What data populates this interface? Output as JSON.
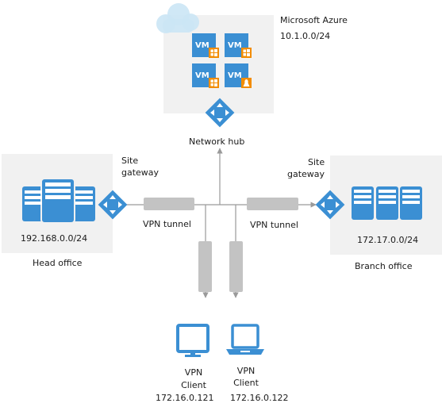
{
  "azure": {
    "title": "Microsoft Azure",
    "subnet": "10.1.0.0/24",
    "vms": [
      {
        "label": "VM",
        "os": "windows"
      },
      {
        "label": "VM",
        "os": "windows"
      },
      {
        "label": "VM",
        "os": "windows"
      },
      {
        "label": "VM",
        "os": "linux"
      }
    ],
    "hub_label": "Network hub"
  },
  "head_office": {
    "name": "Head office",
    "subnet": "192.168.0.0/24",
    "gateway_label_line1": "Site",
    "gateway_label_line2": "gateway",
    "tunnel_label": "VPN tunnel"
  },
  "branch_office": {
    "name": "Branch office",
    "subnet": "172.17.0.0/24",
    "gateway_label_line1": "Site",
    "gateway_label_line2": "gateway",
    "tunnel_label": "VPN tunnel"
  },
  "clients": [
    {
      "line1": "VPN",
      "line2": "Client",
      "ip": "172.16.0.121",
      "device": "desktop"
    },
    {
      "line1": "VPN",
      "line2": "Client",
      "ip": "172.16.0.122",
      "device": "laptop"
    }
  ],
  "colors": {
    "icon_blue": "#3b8fd3",
    "windows_badge": "#f28c00",
    "panel_bg": "#f1f1f1",
    "tunnel_gray": "#c3c3c3",
    "line_gray": "#9a9a9a",
    "cloud": "#cbe6f5"
  }
}
